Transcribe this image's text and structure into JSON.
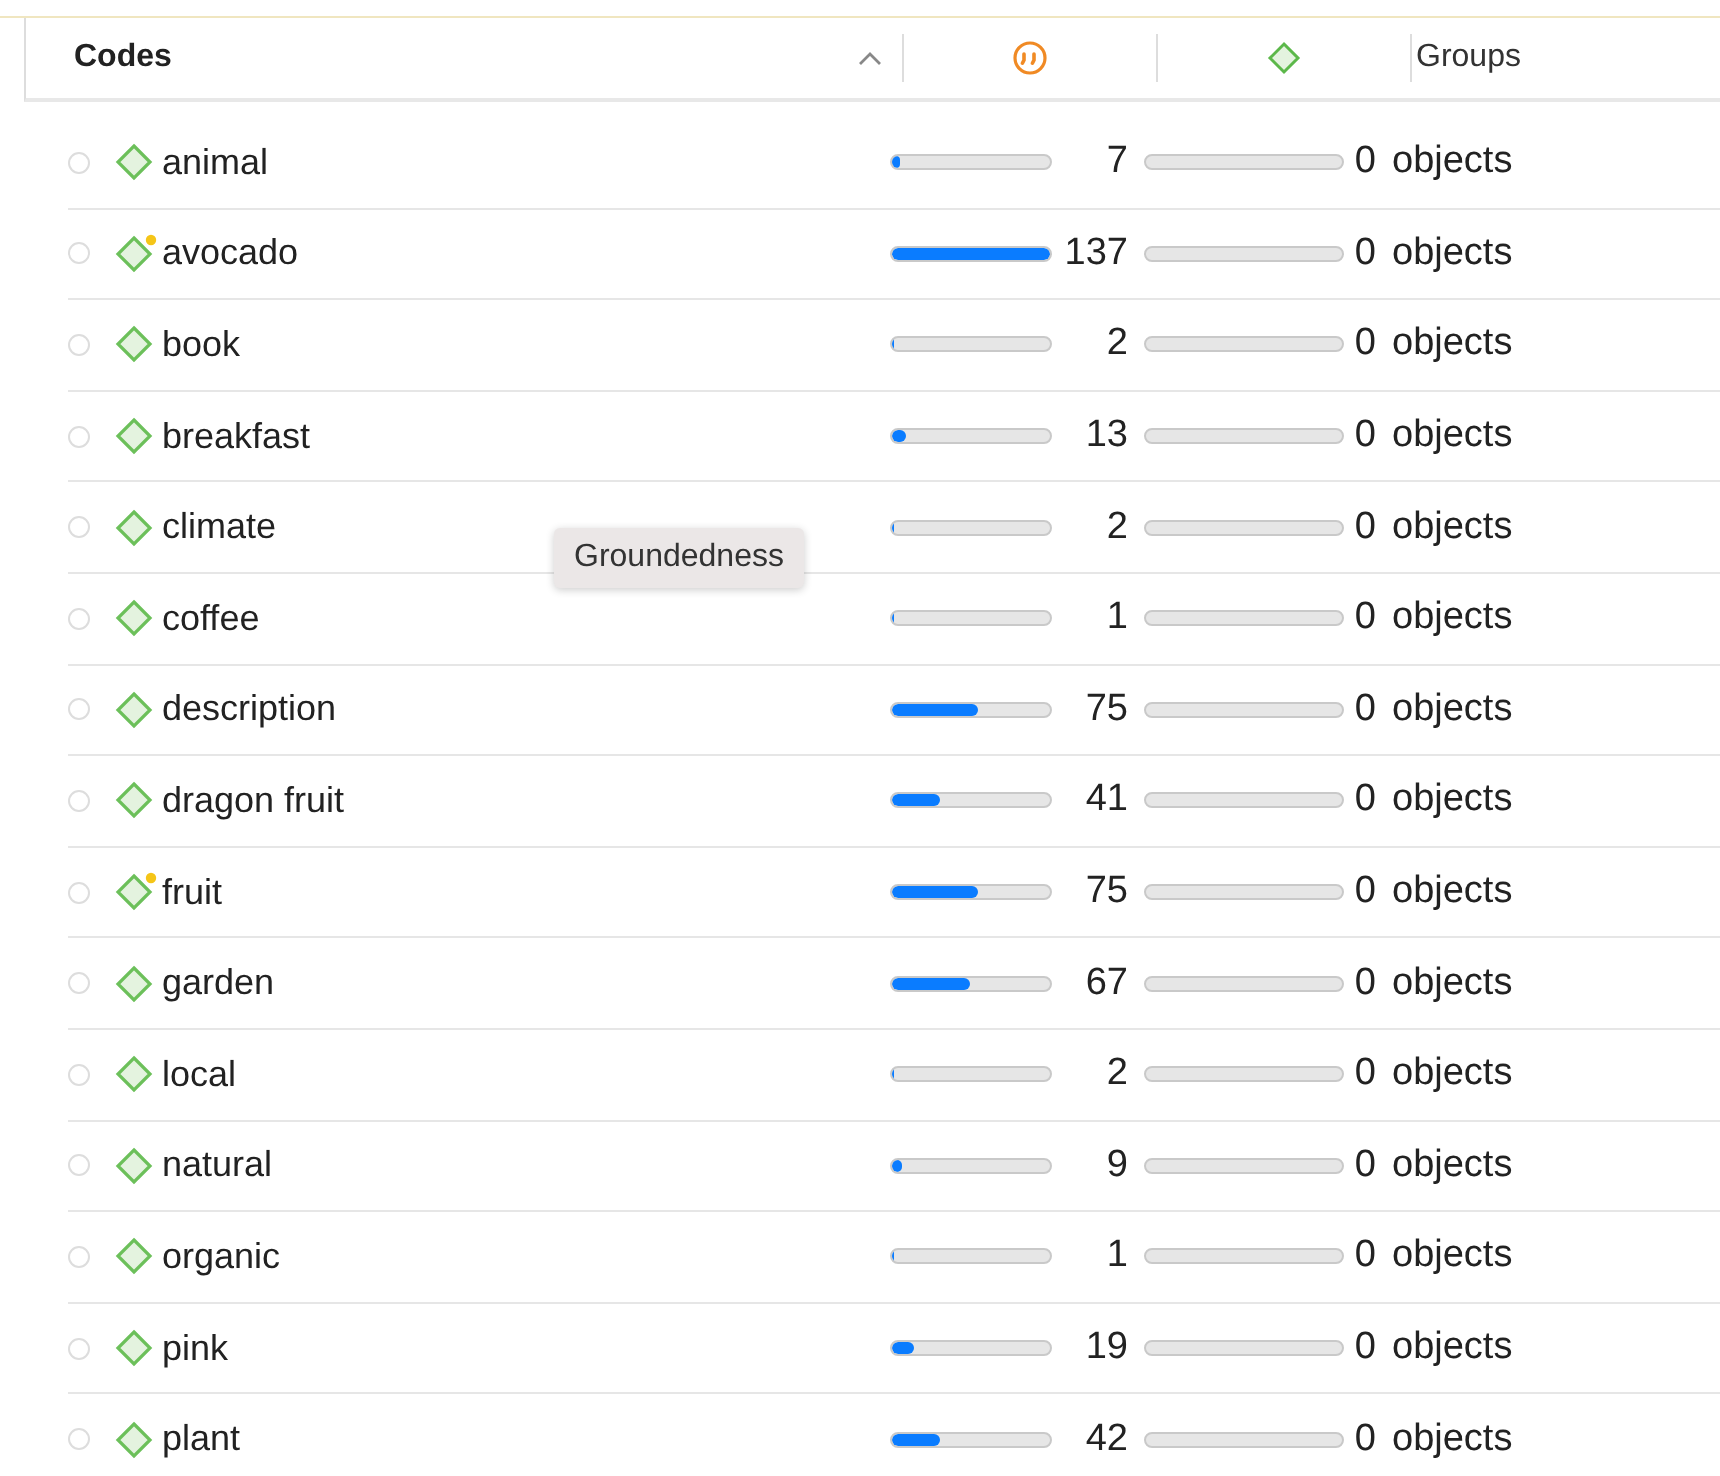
{
  "header": {
    "columns": [
      {
        "kind": "text",
        "label": "Codes",
        "sorted": true
      },
      {
        "kind": "quote"
      },
      {
        "kind": "diamond"
      },
      {
        "kind": "text",
        "label": "Groups",
        "sorted": false
      }
    ]
  },
  "rows": [
    {
      "name": "animal",
      "has_memo": false,
      "quotations": "7",
      "level": 0.05,
      "groups": "0",
      "unit": "objects"
    },
    {
      "name": "avocado",
      "has_memo": true,
      "quotations": "137",
      "level": 1,
      "groups": "0",
      "unit": "objects"
    },
    {
      "name": "book",
      "has_memo": false,
      "quotations": "2",
      "level": 0.015,
      "groups": "0",
      "unit": "objects"
    },
    {
      "name": "breakfast",
      "has_memo": false,
      "quotations": "13",
      "level": 0.09,
      "groups": "0",
      "unit": "objects"
    },
    {
      "name": "climate",
      "has_memo": false,
      "quotations": "2",
      "level": 0.015,
      "groups": "0",
      "unit": "objects"
    },
    {
      "name": "coffee",
      "has_memo": false,
      "quotations": "1",
      "level": 0.007,
      "groups": "0",
      "unit": "objects"
    },
    {
      "name": "description",
      "has_memo": false,
      "quotations": "75",
      "level": 0.55,
      "groups": "0",
      "unit": "objects"
    },
    {
      "name": "dragon fruit",
      "has_memo": false,
      "quotations": "41",
      "level": 0.3,
      "groups": "0",
      "unit": "objects"
    },
    {
      "name": "fruit",
      "has_memo": true,
      "quotations": "75",
      "level": 0.55,
      "groups": "0",
      "unit": "objects"
    },
    {
      "name": "garden",
      "has_memo": false,
      "quotations": "67",
      "level": 0.49,
      "groups": "0",
      "unit": "objects"
    },
    {
      "name": "local",
      "has_memo": false,
      "quotations": "2",
      "level": 0.015,
      "groups": "0",
      "unit": "objects"
    },
    {
      "name": "natural",
      "has_memo": false,
      "quotations": "9",
      "level": 0.066,
      "groups": "0",
      "unit": "objects"
    },
    {
      "name": "organic",
      "has_memo": false,
      "quotations": "1",
      "level": 0.007,
      "groups": "0",
      "unit": "objects"
    },
    {
      "name": "pink",
      "has_memo": false,
      "quotations": "19",
      "level": 0.14,
      "groups": "0",
      "unit": "objects"
    },
    {
      "name": "plant",
      "has_memo": false,
      "quotations": "42",
      "level": 0.31,
      "groups": "0",
      "unit": "objects"
    }
  ],
  "tooltip": {
    "text": "Groundedness"
  }
}
